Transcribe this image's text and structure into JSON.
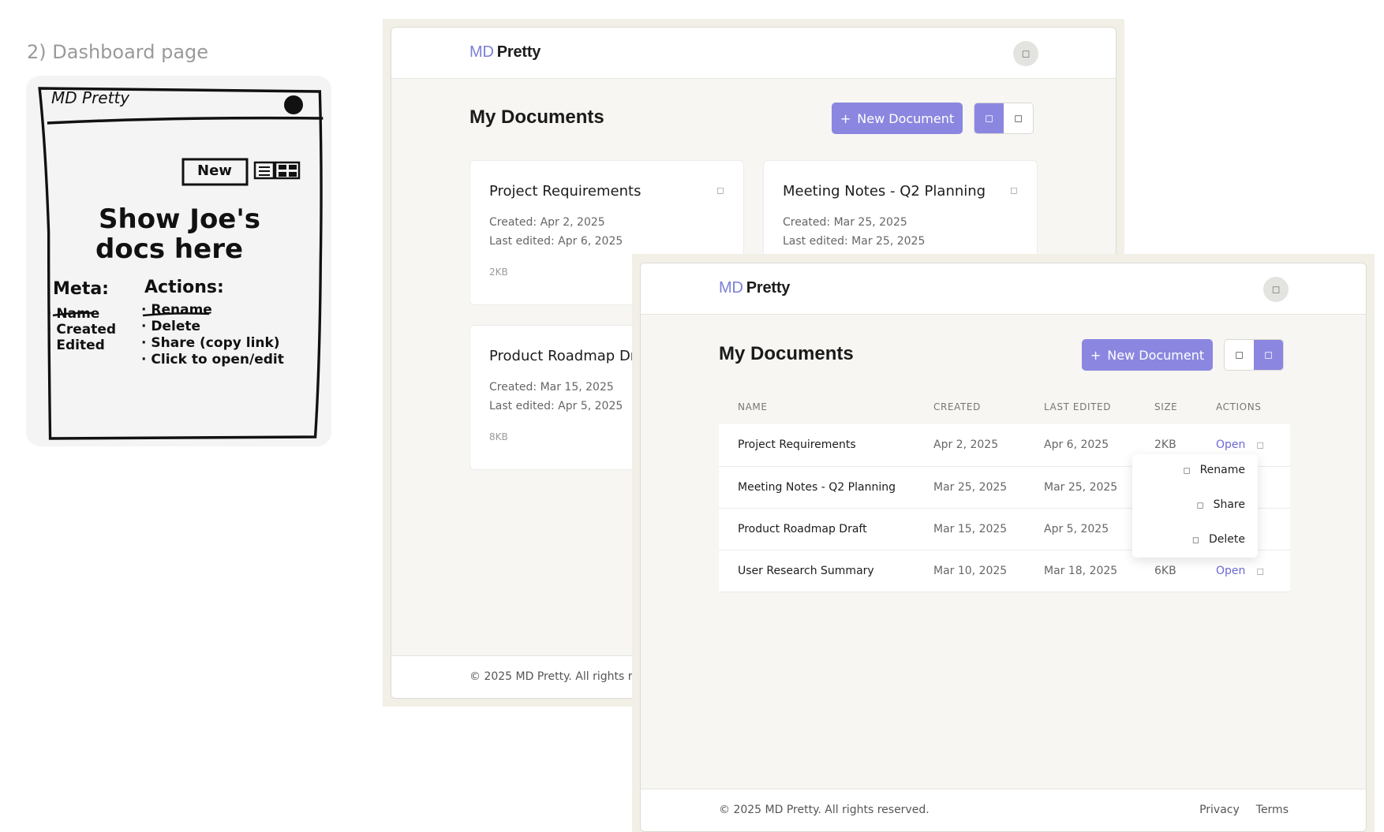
{
  "section_label": "2) Dashboard page",
  "sketch": {
    "logo": "MD Pretty",
    "new_button": "New",
    "headline_line1": "Show Joe's",
    "headline_line2": "docs here",
    "meta_title": "Meta:",
    "meta_items": [
      "Name",
      "Created",
      "Edited"
    ],
    "actions_title": "Actions:",
    "actions_items": [
      "Rename",
      "Delete",
      "Share (copy link)",
      "Click to open/edit"
    ]
  },
  "grid_app": {
    "logo_prefix": "MD",
    "logo_suffix": "Pretty",
    "avatar_icon": "user-icon",
    "page_title": "My Documents",
    "new_doc_label": "New Document",
    "new_doc_icon": "+",
    "view_mode": "grid",
    "cards": [
      {
        "title": "Project Requirements",
        "created": "Created: Apr 2, 2025",
        "edited": "Last edited: Apr 6, 2025",
        "size": "2KB"
      },
      {
        "title": "Meeting Notes - Q2 Planning",
        "created": "Created: Mar 25, 2025",
        "edited": "Last edited: Mar 25, 2025",
        "size": ""
      },
      {
        "title": "Product Roadmap Dr",
        "created": "Created: Mar 15, 2025",
        "edited": "Last edited: Apr 5, 2025",
        "size": "8KB"
      }
    ],
    "footer_copy": "© 2025 MD Pretty. All rights re"
  },
  "list_app": {
    "logo_prefix": "MD",
    "logo_suffix": "Pretty",
    "avatar_icon": "user-icon",
    "page_title": "My Documents",
    "new_doc_label": "New Document",
    "new_doc_icon": "+",
    "view_mode": "list",
    "columns": [
      "NAME",
      "CREATED",
      "LAST EDITED",
      "SIZE",
      "ACTIONS"
    ],
    "rows": [
      {
        "name": "Project Requirements",
        "created": "Apr 2, 2025",
        "edited": "Apr 6, 2025",
        "size": "2KB",
        "action": "Open"
      },
      {
        "name": "Meeting Notes - Q2 Planning",
        "created": "Mar 25, 2025",
        "edited": "Mar 25, 2025",
        "size": "",
        "action": ""
      },
      {
        "name": "Product Roadmap Draft",
        "created": "Mar 15, 2025",
        "edited": "Apr 5, 2025",
        "size": "",
        "action": ""
      },
      {
        "name": "User Research Summary",
        "created": "Mar 10, 2025",
        "edited": "Mar 18, 2025",
        "size": "6KB",
        "action": "Open"
      }
    ],
    "dropdown": [
      "Rename",
      "Share",
      "Delete"
    ],
    "footer_copy": "© 2025 MD Pretty. All rights reserved.",
    "footer_links": [
      "Privacy",
      "Terms"
    ]
  },
  "colors": {
    "accent": "#8b87e0",
    "logo_accent": "#7b7fd6",
    "link": "#6c69d6",
    "page_bg": "#f7f6f2",
    "frame_bg": "#f1efe6"
  }
}
